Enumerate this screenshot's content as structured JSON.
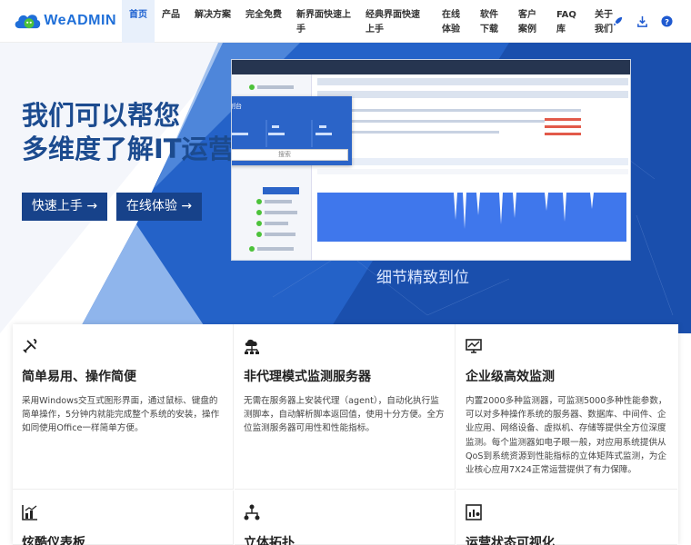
{
  "brand": {
    "name": "WeADMIN"
  },
  "nav": [
    {
      "label": "首页",
      "active": true
    },
    {
      "label": "产品"
    },
    {
      "label": "解决方案"
    },
    {
      "label": "完全免费"
    },
    {
      "label": "新界面快速上手"
    },
    {
      "label": "经典界面快速上手"
    },
    {
      "label": "在线体验"
    },
    {
      "label": "软件下载"
    },
    {
      "label": "客户案例"
    },
    {
      "label": "FAQ库"
    },
    {
      "label": "关于我们"
    }
  ],
  "header_icons": [
    "rocket-icon",
    "download-icon",
    "help-icon"
  ],
  "hero": {
    "line1": "我们可以帮您",
    "line2": "多维度了解IT运营",
    "btn_start": "快速上手 →",
    "btn_demo": "在线体验 →",
    "caption": "细节精致到位",
    "mock": {
      "panel_title": "控制台",
      "search": "搜索"
    }
  },
  "features": [
    {
      "icon": "tools-icon",
      "title": "简单易用、操作简便",
      "desc": "采用Windows交互式图形界面，通过鼠标、键盘的简单操作，5分钟内就能完成整个系统的安装，操作如同使用Office一样简单方便。"
    },
    {
      "icon": "cloud-network-icon",
      "title": "非代理模式监测服务器",
      "desc": "无需在服务器上安装代理（agent），自动化执行监测脚本，自动解析脚本返回值，使用十分方便。全方位监测服务器可用性和性能指标。"
    },
    {
      "icon": "monitor-chart-icon",
      "title": "企业级高效监测",
      "desc": "内置2000多种监测器，可监测5000多种性能参数，可以对多种操作系统的服务器、数据库、中间件、企业应用、网络设备、虚拟机、存储等提供全方位深度监测。每个监测器如电子眼一般，对应用系统提供从QoS到系统资源到性能指标的立体矩阵式监测，为企业核心应用7X24正常运营提供了有力保障。"
    },
    {
      "icon": "dashboard-icon",
      "title": "炫酷仪表板",
      "desc": ""
    },
    {
      "icon": "topology-icon",
      "title": "立体拓扑",
      "desc": ""
    },
    {
      "icon": "status-icon",
      "title": "运营状态可视化",
      "desc": ""
    }
  ]
}
